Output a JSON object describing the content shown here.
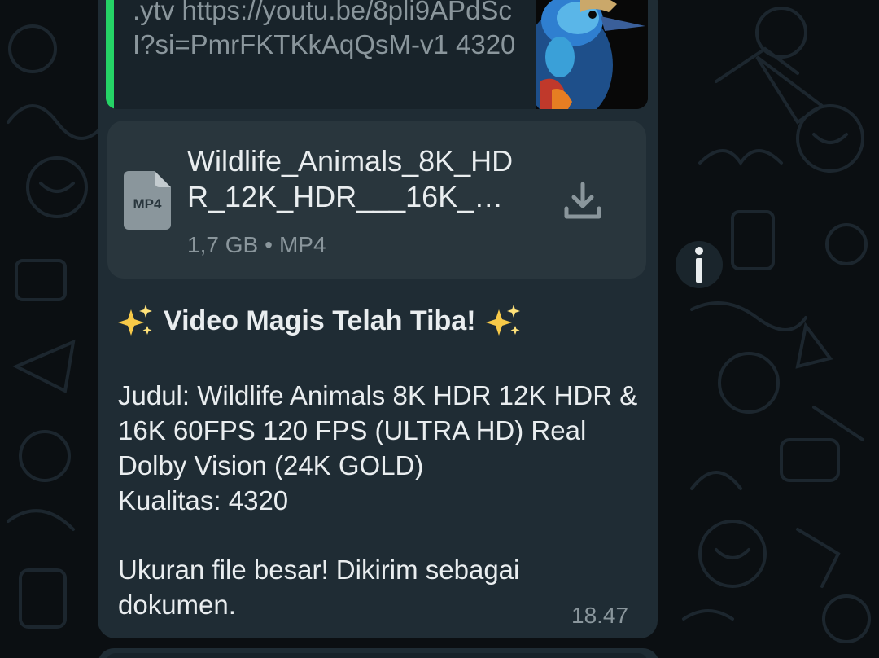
{
  "quoted": {
    "text": ".ytv https://youtu.be/8pli9APdScI?si=PmrFKTKkAqQsM-v1 4320"
  },
  "document": {
    "icon_label": "MP4",
    "name": "Wildlife_Animals_8K_HDR_12K_HDR___16K_…",
    "size": "1,7 GB",
    "separator": "•",
    "type": "MP4"
  },
  "message": {
    "headline": "Video Magis Telah Tiba!",
    "line1": "Judul: Wildlife Animals 8K HDR 12K HDR & 16K 60FPS 120 FPS (ULTRA HD) Real Dolby Vision (24K GOLD)",
    "line2": "Kualitas: 4320",
    "line3": "Ukuran file besar! Dikirim sebagai dokumen.",
    "time": "18.47"
  },
  "colors": {
    "bubble": "#1f2c34",
    "quote_accent": "#25d366",
    "text_primary": "#e9edef",
    "text_secondary": "#8a969c"
  },
  "icons": {
    "download": "download-icon",
    "info": "info-icon",
    "sparkles": "sparkles-icon",
    "document": "mp4-file-icon"
  }
}
